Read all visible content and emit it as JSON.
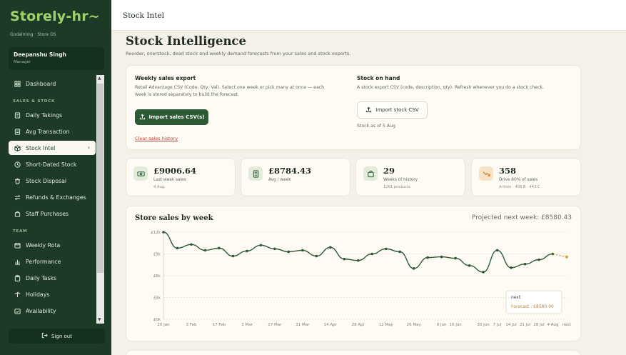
{
  "app": {
    "logo_text": "Storely",
    "logo_suffix": "hr",
    "org": "Godalming · Store OS"
  },
  "user": {
    "name": "Deepanshu Singh",
    "role": "Manager"
  },
  "sidebar": {
    "sections": {
      "sales": "SALES & STOCK",
      "team": "TEAM"
    },
    "items": [
      {
        "label": "Dashboard",
        "icon": "grid-icon"
      },
      {
        "label": "Daily Takings",
        "icon": "receipt-icon"
      },
      {
        "label": "Avg Transaction",
        "icon": "calculator-icon"
      },
      {
        "label": "Stock Intel",
        "icon": "box-icon",
        "active": true
      },
      {
        "label": "Short-Dated Stock",
        "icon": "clock-icon"
      },
      {
        "label": "Stock Disposal",
        "icon": "trash-icon"
      },
      {
        "label": "Refunds & Exchanges",
        "icon": "swap-icon"
      },
      {
        "label": "Staff Purchases",
        "icon": "bag-icon"
      },
      {
        "label": "Weekly Rota",
        "icon": "calendar-icon"
      },
      {
        "label": "Performance",
        "icon": "bar-chart-icon"
      },
      {
        "label": "Daily Tasks",
        "icon": "clipboard-icon"
      },
      {
        "label": "Holidays",
        "icon": "palm-icon"
      },
      {
        "label": "Availability",
        "icon": "calendar-check-icon"
      }
    ],
    "signout_label": "Sign out"
  },
  "topbar": {
    "title": "Stock Intel"
  },
  "page": {
    "title": "Stock Intelligence",
    "subtitle": "Reorder, overstock, dead stock and weekly demand forecasts from your sales and stock exports."
  },
  "upload": {
    "sales_heading": "Weekly sales export",
    "sales_desc_1": "Retail Advantage CSV (Code, Qty, Val). Select one week or pick many at once — each",
    "sales_desc_2": "week is stored separately to build the forecast.",
    "sales_button": "Import sales CSV(s)",
    "clear_link": "Clear sales history",
    "stock_heading": "Stock on hand",
    "stock_desc": "A stock export CSV (code, description, qty). Refresh whenever you do a stock check.",
    "stock_button": "Import stock CSV",
    "stock_as_of": "Stock as of 5 Aug"
  },
  "kpis": [
    {
      "value": "£9006.64",
      "label": "Last week sales",
      "sub": "4 Aug",
      "icon": "cash-icon"
    },
    {
      "value": "£8784.43",
      "label": "Avg / week",
      "sub": "",
      "icon": "calculator-icon"
    },
    {
      "value": "29",
      "label": "Weeks of history",
      "sub": "1261 products",
      "icon": "bag-icon"
    },
    {
      "value": "358",
      "label": "Drive 80% of sales",
      "sub": "A-lines · 408 B · 443 C",
      "icon": "trend-down-icon"
    }
  ],
  "chart": {
    "title": "Store sales by week",
    "projection": "Projected next week: £8580.43",
    "tooltip_title": "next",
    "tooltip_value": "Forecast : £8580.00"
  },
  "colors": {
    "primary": "#2d5a34",
    "sidebar": "#1d3a26",
    "forecast": "#d9a03f",
    "danger": "#b3463a"
  },
  "chart_data": {
    "type": "line",
    "x": [
      "20 Jan",
      "27 Jan",
      "3 Feb",
      "10 Feb",
      "17 Feb",
      "24 Feb",
      "3 Mar",
      "10 Mar",
      "17 Mar",
      "24 Mar",
      "31 Mar",
      "7 Apr",
      "14 Apr",
      "21 Apr",
      "28 Apr",
      "5 May",
      "12 May",
      "19 May",
      "26 May",
      "2 Jun",
      "9 Jun",
      "16 Jun",
      "23 Jun",
      "30 Jun",
      "7 Jul",
      "14 Jul",
      "21 Jul",
      "28 Jul",
      "4 Aug",
      "next"
    ],
    "x_tick_labels": [
      "20 Jan",
      "3 Feb",
      "17 Feb",
      "3 Mar",
      "17 Mar",
      "31 Mar",
      "14 Apr",
      "28 Apr",
      "12 May",
      "26 May",
      "9 Jun",
      "16 Jun",
      "30 Jun",
      "7 Jul",
      "14 Jul",
      "21 Jul",
      "28 Jul",
      "4 Aug",
      "next"
    ],
    "y_tick_labels": [
      "£0k",
      "£3k",
      "£6k",
      "£9k",
      "£12k"
    ],
    "series": [
      {
        "values": [
          12000,
          9800,
          10300,
          9500,
          9800,
          8700,
          9400,
          10200,
          9700,
          9300,
          9500,
          8700,
          9900,
          8300,
          8100,
          9000,
          9700,
          9300,
          7000,
          8500,
          8600,
          8400,
          7400,
          6500,
          9500,
          7100,
          7600,
          8200,
          9006.64,
          null
        ]
      },
      {
        "name": "Forecast",
        "values": [
          null,
          null,
          null,
          null,
          null,
          null,
          null,
          null,
          null,
          null,
          null,
          null,
          null,
          null,
          null,
          null,
          null,
          null,
          null,
          null,
          null,
          null,
          null,
          null,
          null,
          null,
          null,
          null,
          9006.64,
          8580.43
        ]
      }
    ],
    "ylim": [
      0,
      12000
    ],
    "grid": true
  }
}
